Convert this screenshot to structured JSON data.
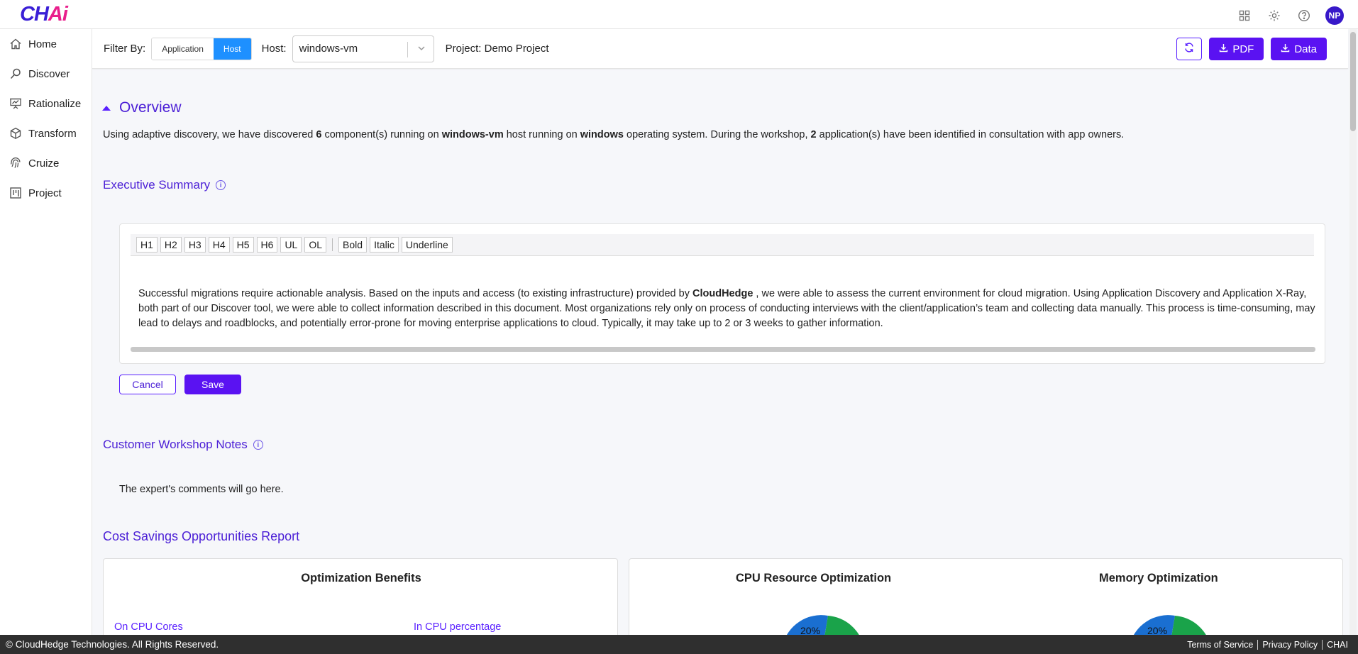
{
  "app": {
    "logo_main": "CH",
    "logo_accent": "Ai"
  },
  "topbar": {
    "avatar_initials": "NP"
  },
  "sidebar": {
    "items": [
      {
        "label": "Home",
        "icon": "home-icon"
      },
      {
        "label": "Discover",
        "icon": "search-icon"
      },
      {
        "label": "Rationalize",
        "icon": "presentation-icon"
      },
      {
        "label": "Transform",
        "icon": "cube-icon"
      },
      {
        "label": "Cruize",
        "icon": "fingerprint-icon"
      },
      {
        "label": "Project",
        "icon": "kanban-icon"
      }
    ]
  },
  "filter": {
    "label": "Filter By:",
    "options": [
      "Application",
      "Host"
    ],
    "active_option": "Host",
    "host_label": "Host:",
    "host_value": "windows-vm",
    "project_text": "Project: Demo Project",
    "pdf_label": "PDF",
    "data_label": "Data"
  },
  "overview": {
    "title": "Overview",
    "p1": "Using adaptive discovery, we have discovered ",
    "components": "6",
    "p2": " component(s) running on ",
    "host": "windows-vm",
    "p3": " host running on ",
    "os": "windows",
    "p4": " operating system. During the workshop, ",
    "apps": "2",
    "p5": " application(s) have been identified in consultation with app owners."
  },
  "executive_summary": {
    "title": "Executive Summary",
    "toolbar": [
      "H1",
      "H2",
      "H3",
      "H4",
      "H5",
      "H6",
      "UL",
      "OL"
    ],
    "toolbar2": [
      "Bold",
      "Italic",
      "Underline"
    ],
    "text1": "Successful migrations require actionable analysis. Based on the inputs and access (to existing infrastructure) provided by ",
    "company": "CloudHedge",
    "text2": " , we were able to assess the current environment for cloud migration. Using Application Discovery and Application X-Ray, both part of our Discover tool, we were able to collect information described in this document.   Most organizations rely only on process of conducting interviews with the client/application’s team and collecting data manually. This process is time-consuming, may lead to delays and roadblocks, and potentially error-prone for moving enterprise applications to cloud. Typically, it may take up to 2 or 3 weeks to gather information.",
    "cancel_label": "Cancel",
    "save_label": "Save"
  },
  "workshop_notes": {
    "title": "Customer Workshop Notes",
    "text": "The expert's comments will go here."
  },
  "cost_savings": {
    "title": "Cost Savings Opportunities Report",
    "optimization_title": "Optimization Benefits",
    "link_cpu_cores": "On CPU Cores",
    "link_cpu_percentage": "In CPU percentage",
    "cpu_chart_title": "CPU Resource Optimization",
    "memory_chart_title": "Memory Optimization",
    "cpu_slice_label": "20%",
    "memory_slice_label": "20%",
    "colors": {
      "blue": "#1a6fd1",
      "green": "#1aa34a",
      "yellow": "#f2c94c"
    }
  },
  "footer": {
    "copyright": "© CloudHedge Technologies. All Rights Reserved.",
    "links": [
      "Terms of Service",
      "Privacy Policy",
      "CHAI"
    ]
  }
}
